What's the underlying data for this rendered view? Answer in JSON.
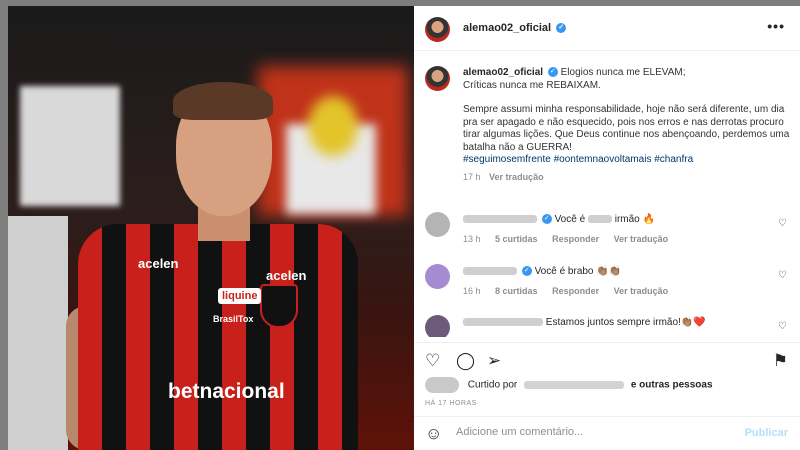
{
  "post": {
    "username": "alemao02_oficial",
    "more_icon": "more-horizontal-icon",
    "caption": {
      "line1": "Elogios nunca me ELEVAM;",
      "line2": "Críticas nunca me REBAIXAM.",
      "body": "Sempre assumi minha responsabilidade, hoje não será diferente, um dia pra ser apagado e não esquecido, pois nos erros e nas derrotas procuro tirar algumas lições. Que Deus continue nos abençoando, perdemos uma batalha não a GUERRA!",
      "hashtags": "#seguimosemfrente #oontemnaovoltamais #chanfra",
      "age": "17 h",
      "translate": "Ver tradução"
    },
    "comments": [
      {
        "text_prefix": "Você é",
        "text_suffix": "irmão 🔥",
        "age": "13 h",
        "likes": "5 curtidas",
        "reply": "Responder",
        "translate": "Ver tradução"
      },
      {
        "text_prefix": "Você é brabo 👏🏽👏🏽",
        "text_suffix": "",
        "age": "16 h",
        "likes": "8 curtidas",
        "reply": "Responder",
        "translate": "Ver tradução"
      },
      {
        "text_prefix": "Estamos juntos sempre irmão!👏🏽❤️",
        "text_suffix": "",
        "age": "",
        "likes": "",
        "reply": "",
        "translate": ""
      }
    ],
    "likes_prefix": "Curtido por",
    "likes_suffix": "outras pessoas",
    "timestamp": "HÁ 17 HORAS",
    "add_comment_placeholder": "Adicione um comentário...",
    "publish_label": "Publicar"
  },
  "photo": {
    "sponsor_1": "acelen",
    "sponsor_2": "acelen",
    "sponsor_3": "liquine",
    "sponsor_4": "BrasilTox",
    "sponsor_5": "betnacional"
  },
  "colors": {
    "link": "#00376b",
    "verified": "#3897f0",
    "publish_disabled": "#b2dffc",
    "shirt_red": "#c8201a"
  }
}
